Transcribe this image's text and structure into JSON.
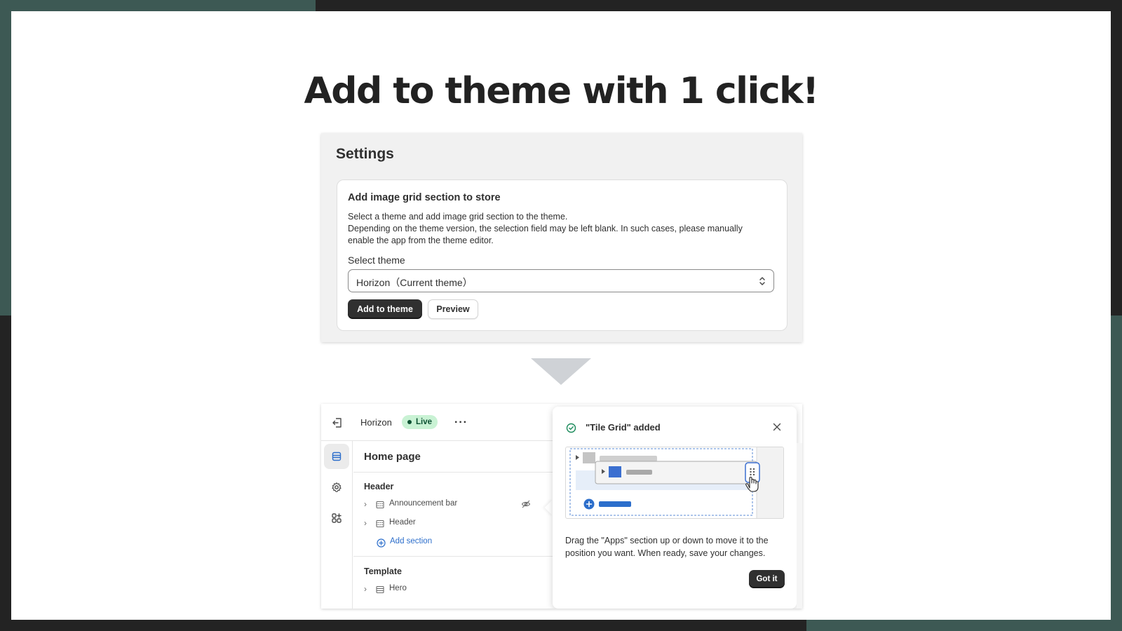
{
  "headline": "Add to theme with 1 click!",
  "settings": {
    "title": "Settings",
    "card_title": "Add image grid section to store",
    "description_line1": "Select a theme and add image grid section to the theme.",
    "description_line2": "Depending on the theme version, the selection field may be left blank. In such cases, please manually",
    "description_line3": "enable the app from the theme editor.",
    "select_label": "Select theme",
    "select_value": "Horizon（Current theme）",
    "add_button": "Add to theme",
    "preview_button": "Preview"
  },
  "editor": {
    "theme_name": "Horizon",
    "live_badge": "Live",
    "more_label": "···",
    "page_title": "Home page",
    "header_group": "Header",
    "header_items": [
      {
        "label": "Announcement bar"
      },
      {
        "label": "Header"
      }
    ],
    "add_section": "Add section",
    "template_group": "Template",
    "template_items": [
      {
        "label": "Hero"
      }
    ]
  },
  "popover": {
    "title": "\"Tile Grid\" added",
    "body": "Drag the \"Apps\" section up or down to move it to the position you want. When ready, save your changes.",
    "button": "Got it"
  },
  "colors": {
    "accent_teal": "#3d5954",
    "dark": "#232323",
    "primary_button": "#303030",
    "link_blue": "#2c6ecb",
    "live_green_bg": "#c9f2d4"
  }
}
